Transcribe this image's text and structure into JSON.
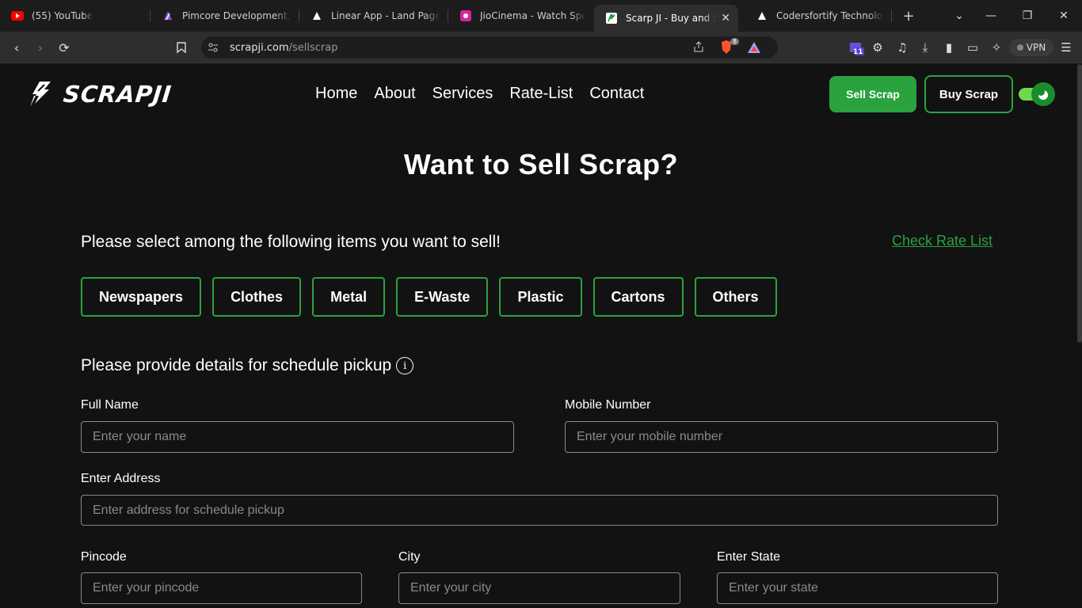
{
  "browser": {
    "tabs": [
      {
        "title": "(55) YouTube",
        "icon": "youtube-icon",
        "color": "#ff0000"
      },
      {
        "title": "Pimcore Development, Sy",
        "icon": "pimcore-icon",
        "color": "#6428b4"
      },
      {
        "title": "Linear App - Land Page Cl",
        "icon": "triangle-icon",
        "color": "#ffffff"
      },
      {
        "title": "JioCinema - Watch Sports",
        "icon": "jiocinema-icon",
        "color": "#d6249f"
      },
      {
        "title": "Scarp JI - Buy and Sel",
        "icon": "scrapji-icon",
        "color": "#ffffff",
        "active": true
      },
      {
        "title": "Codersfortify Technologie",
        "icon": "triangle-icon",
        "color": "#ffffff"
      }
    ],
    "url_host": "scrapji.com",
    "url_path": "/sellscrap",
    "vpn_label": "VPN",
    "extension_badge": "11",
    "brave_badge": "8"
  },
  "site": {
    "logo_text": "SCRAPJI",
    "nav": [
      "Home",
      "About",
      "Services",
      "Rate-List",
      "Contact"
    ],
    "sell_button": "Sell Scrap",
    "buy_button": "Buy Scrap",
    "theme_toggle_on": true,
    "accent_color": "#2aa23e"
  },
  "main": {
    "heading": "Want to Sell Scrap?",
    "select_title": "Please select among the following items you want to sell!",
    "rate_link": "Check Rate List",
    "items": [
      "Newspapers",
      "Clothes",
      "Metal",
      "E-Waste",
      "Plastic",
      "Cartons",
      "Others"
    ],
    "details_title": "Please provide details for schedule pickup",
    "form": {
      "full_name_label": "Full Name",
      "full_name_placeholder": "Enter your name",
      "mobile_label": "Mobile Number",
      "mobile_placeholder": "Enter your mobile number",
      "address_label": "Enter Address",
      "address_placeholder": "Enter address for schedule pickup",
      "pincode_label": "Pincode",
      "pincode_placeholder": "Enter your pincode",
      "city_label": "City",
      "city_placeholder": "Enter your city",
      "state_label": "Enter State",
      "state_placeholder": "Enter your state"
    }
  }
}
